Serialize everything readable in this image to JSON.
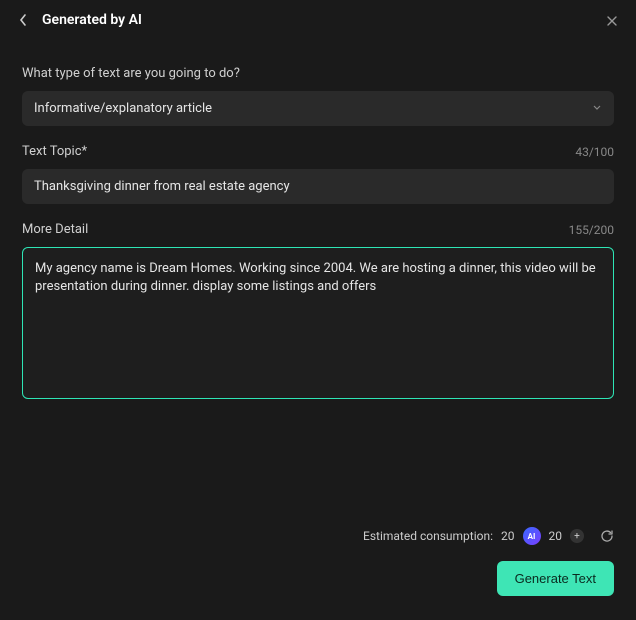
{
  "header": {
    "title": "Generated by AI"
  },
  "q1": {
    "label": "What type of text are you going to do?",
    "value": "Informative/explanatory article"
  },
  "q2": {
    "label": "Text Topic*",
    "counter": "43/100",
    "value": "Thanksgiving dinner from real estate agency"
  },
  "q3": {
    "label": "More Detail",
    "counter": "155/200",
    "value": "My agency name is Dream Homes. Working since 2004. We are hosting a dinner, this video will be presentation during dinner. display some listings and offers"
  },
  "footer": {
    "consumption_label": "Estimated consumption:",
    "consumption_value": "20",
    "credits": "20",
    "ai_badge": "AI",
    "generate_label": "Generate Text"
  }
}
